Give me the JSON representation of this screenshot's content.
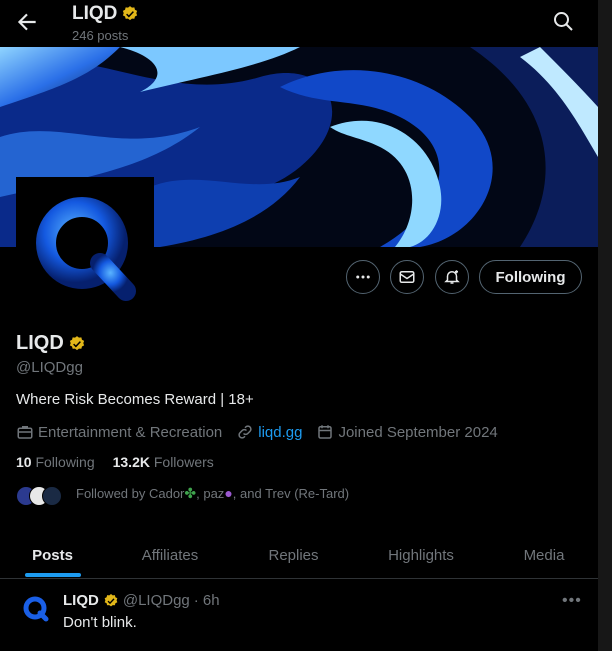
{
  "header": {
    "title": "LIQD",
    "posts_count": "246 posts"
  },
  "profile": {
    "name": "LIQD",
    "handle": "@LIQDgg",
    "bio": "Where Risk Becomes Reward | 18+",
    "category": "Entertainment & Recreation",
    "website": "liqd.gg",
    "joined": "Joined September 2024",
    "following_count": "10",
    "following_label": "Following",
    "followers_count": "13.2K",
    "followers_label": "Followers",
    "followed_by_prefix": "Followed by Cador",
    "followed_by_mid": ", paz",
    "followed_by_suffix": ", and Trev (Re-Tard)"
  },
  "actions": {
    "follow_label": "Following"
  },
  "tabs": [
    {
      "label": "Posts",
      "active": true
    },
    {
      "label": "Affiliates",
      "active": false
    },
    {
      "label": "Replies",
      "active": false
    },
    {
      "label": "Highlights",
      "active": false
    },
    {
      "label": "Media",
      "active": false
    }
  ],
  "post": {
    "author": "LIQD",
    "handle": "@LIQDgg",
    "time": "· 6h",
    "text": "Don't blink."
  },
  "colors": {
    "accent": "#1d9bf0",
    "verified": "#e2b719",
    "background": "#000000"
  },
  "icons": [
    "back-arrow-icon",
    "search-icon",
    "more-icon",
    "mail-icon",
    "bell-plus-icon",
    "briefcase-icon",
    "link-icon",
    "calendar-icon",
    "verified-badge-icon"
  ]
}
